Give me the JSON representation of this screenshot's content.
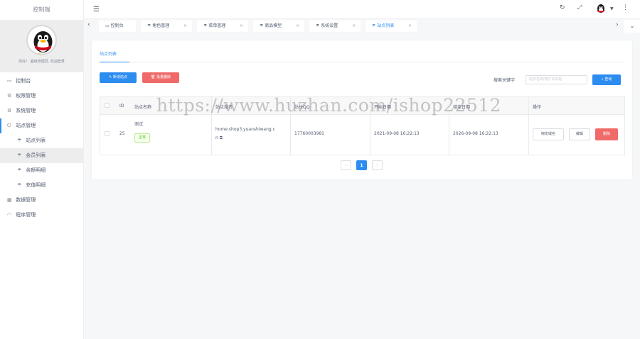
{
  "sidebar": {
    "brand": "控制端",
    "welcome": "你好！ 超级管理员, 欢迎登录",
    "menu": [
      {
        "label": "控制台",
        "icon": "monitor-icon"
      },
      {
        "label": "权限管理",
        "icon": "gear-icon"
      },
      {
        "label": "系统管理",
        "icon": "gear-icon"
      },
      {
        "label": "站点管理",
        "icon": "power-icon"
      },
      {
        "label": "站点列表",
        "icon": "umbrella-icon"
      },
      {
        "label": "会员列表",
        "icon": "umbrella-icon"
      },
      {
        "label": "余额明细",
        "icon": "umbrella-icon"
      },
      {
        "label": "充值明细",
        "icon": "umbrella-icon"
      },
      {
        "label": "数据管理",
        "icon": "grid-icon"
      },
      {
        "label": "程序管理",
        "icon": "wifi-icon"
      }
    ]
  },
  "topbar": {
    "icons": [
      "menu-icon",
      "refresh-icon",
      "fullscreen-icon",
      "user-avatar",
      "more-icon"
    ]
  },
  "tabs": [
    {
      "label": "控制台"
    },
    {
      "label": "角色管理"
    },
    {
      "label": "菜单管理"
    },
    {
      "label": "商品模型"
    },
    {
      "label": "系统设置"
    },
    {
      "label": "站点列表"
    }
  ],
  "content": {
    "tab_label": "站点列表",
    "add_button": "新增站点",
    "batch_delete_button": "批量删除",
    "search_label": "搜索关键字",
    "search_placeholder": "站点名称/用户QQ/站",
    "search_button": "查询"
  },
  "table": {
    "columns": [
      "ID",
      "站点名称",
      "站点域名",
      "站长QQ",
      "开始日期",
      "结束日期",
      "操作"
    ],
    "rows": [
      {
        "id": "25",
        "name": "测试",
        "status": "正常",
        "domain_line1": "home.shop3.yuanshiwang.c",
        "domain_line2": "n",
        "qq": "17760003981",
        "start": "2021-09-08 16:22:13",
        "end": "2026-09-08 16:22:13",
        "actions": [
          "绑定域名",
          "编辑",
          "删除"
        ]
      }
    ]
  },
  "pagination": {
    "prev": "‹",
    "current": "1",
    "next": "›"
  },
  "watermark": "https://www.huzhan.com/ishop22512",
  "colors": {
    "primary": "#2d8cf0",
    "danger": "#ed4014",
    "success": "#52c41a"
  }
}
